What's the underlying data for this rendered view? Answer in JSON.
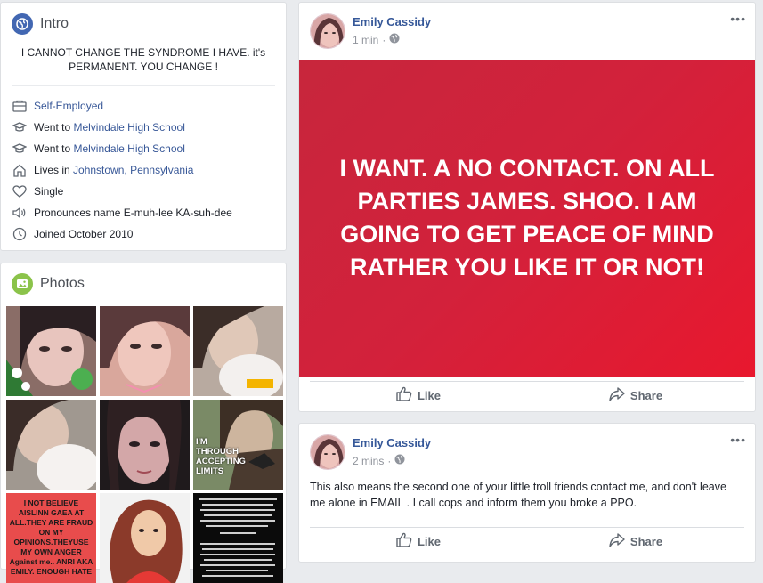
{
  "intro": {
    "title": "Intro",
    "bio": "I CANNOT CHANGE THE SYNDROME I HAVE. it's PERMANENT. YOU CHANGE !",
    "work": "Self-Employed",
    "edu1_prefix": "Went to ",
    "edu1_school": "Melvindale High School",
    "edu2_prefix": "Went to ",
    "edu2_school": "Melvindale High School",
    "lives_prefix": "Lives in ",
    "lives_city": "Johnstown, Pennsylvania",
    "relationship": "Single",
    "pronounce": "Pronounces name E-muh-lee KA-suh-dee",
    "joined": "Joined October 2010"
  },
  "photos": {
    "title": "Photos",
    "overlay_text_6": "I'M THROUGH ACCEPTING LIMITS",
    "overlay_text_7": "I NOT BELIEVE AISLINN GAEA AT ALL.THEY ARE FRAUD ON MY OPINIONS.THEYUSE MY OWN ANGER Against me.. ANRI AKA EMILY. ENOUGH HATE"
  },
  "post1": {
    "author": "Emily Cassidy",
    "time": "1 min",
    "banner_text": "I WANT. A NO CONTACT. ON ALL PARTIES JAMES. SHOO. I AM GOING TO GET PEACE OF MIND RATHER YOU LIKE IT OR NOT!",
    "like": "Like",
    "share": "Share",
    "more": "•••"
  },
  "post2": {
    "author": "Emily Cassidy",
    "time": "2 mins",
    "text": "This also means the second one of your little troll friends contact me, and don't leave me alone in EMAIL . I call cops and inform them you broke a PPO.",
    "like": "Like",
    "share": "Share",
    "more": "•••"
  },
  "colors": {
    "link": "#385898",
    "banner": "#d3213b",
    "page_bg": "#e9ebee"
  }
}
